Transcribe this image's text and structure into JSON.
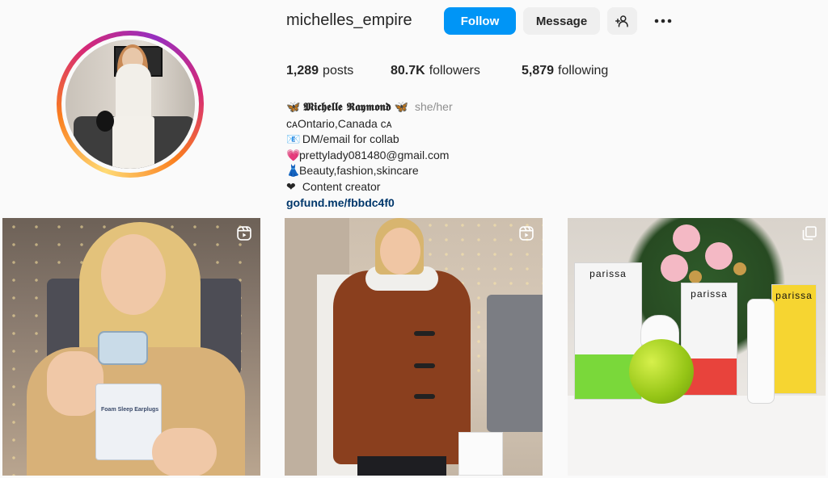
{
  "profile": {
    "username": "michelles_empire",
    "follow_label": "Follow",
    "message_label": "Message",
    "stats": {
      "posts_count": "1,289",
      "posts_label": "posts",
      "followers_count": "80.7K",
      "followers_label": "followers",
      "following_count": "5,879",
      "following_label": "following"
    },
    "bio": {
      "name": "𝕸𝖎𝖈𝖍𝖊𝖑𝖑𝖊 𝕽𝖆𝖞𝖒𝖔𝖓𝖉",
      "pronouns": "she/her",
      "location": "ᴄᴀOntario,Canada ᴄᴀ",
      "line1": "DM/email for collab",
      "line2": "prettylady081480@gmail.com",
      "line3": "Beauty,fashion,skincare",
      "line4": "Content creator",
      "link": "gofund.me/fbbdc4f0"
    }
  },
  "posts": [
    {
      "type_icon": "reel-icon",
      "product_text": "Foam Sleep Earplugs"
    },
    {
      "type_icon": "reel-icon"
    },
    {
      "type_icon": "carousel-icon",
      "brand": "parissa"
    }
  ],
  "colors": {
    "accent": "#0095f6",
    "link": "#00376b",
    "secondary_button": "#efefef",
    "muted_text": "#8e8e8e"
  }
}
